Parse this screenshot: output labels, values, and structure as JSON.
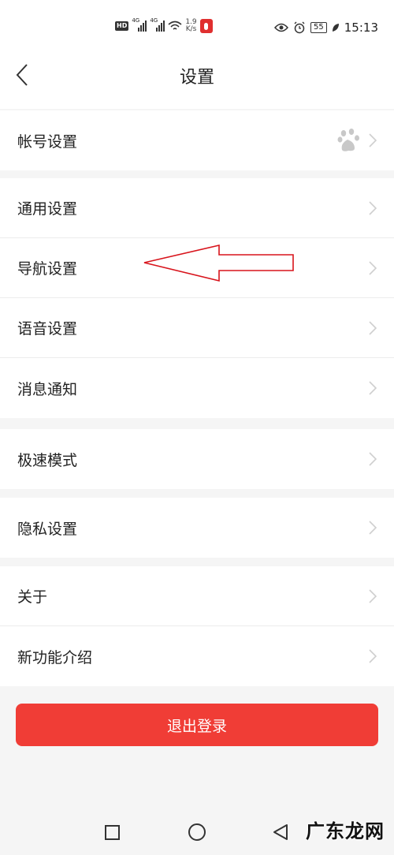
{
  "status_bar": {
    "network_speed_value": "1.9",
    "network_speed_unit": "K/s",
    "signal_label_1": "4G",
    "signal_label_2": "4G",
    "hd_label": "HD",
    "battery_level": "55",
    "time": "15:13"
  },
  "header": {
    "title": "设置"
  },
  "account_group": {
    "items": [
      {
        "label": "帐号设置",
        "icon": "baidu-paw-icon"
      }
    ]
  },
  "settings_group": {
    "items": [
      {
        "label": "通用设置"
      },
      {
        "label": "导航设置"
      },
      {
        "label": "语音设置"
      },
      {
        "label": "消息通知"
      }
    ]
  },
  "mode_group": {
    "items": [
      {
        "label": "极速模式"
      }
    ]
  },
  "privacy_group": {
    "items": [
      {
        "label": "隐私设置"
      }
    ]
  },
  "about_group": {
    "items": [
      {
        "label": "关于"
      },
      {
        "label": "新功能介绍"
      }
    ]
  },
  "logout": {
    "label": "退出登录"
  },
  "watermark": {
    "text": "广东龙网"
  },
  "colors": {
    "accent_red": "#f03d36",
    "annotation_red": "#d8141c",
    "background": "#f5f5f5"
  }
}
